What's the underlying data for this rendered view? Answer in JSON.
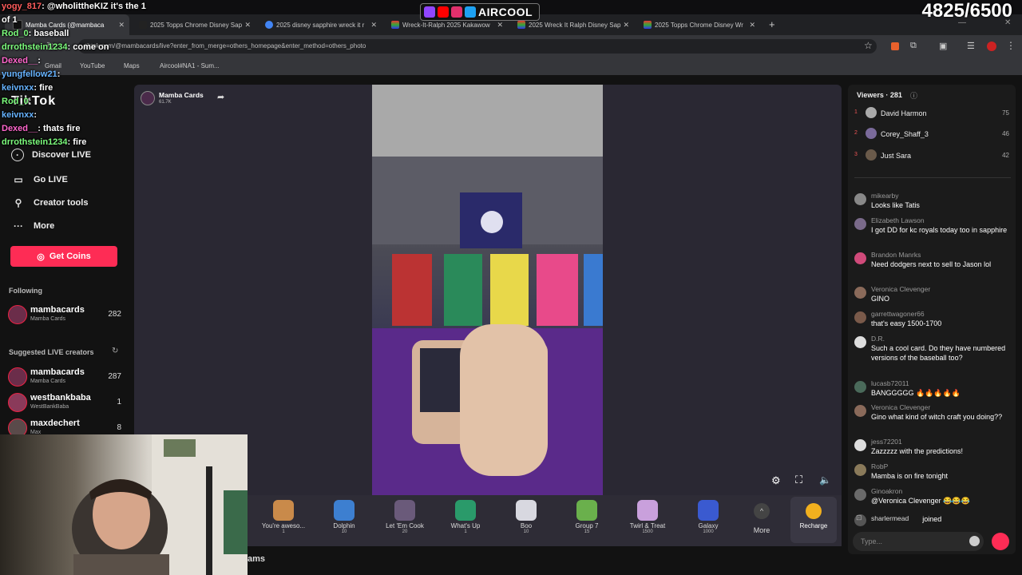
{
  "overlay": {
    "brand": "AIRCOOL",
    "goal_counter": "4825/6500",
    "chat": [
      {
        "user": "yogy_817",
        "text": ": @wholittheKIZ it's the 1",
        "color": "#ff5c5c"
      },
      {
        "user": "",
        "text": "of 1",
        "color": "#ffffff"
      },
      {
        "user": "Rod_0",
        "text": ": baseball",
        "color": "#7cfc7c"
      },
      {
        "user": "drrothstein1234",
        "text": ": come on",
        "color": "#7cfc7c"
      },
      {
        "user": "Dexed__",
        "text": ":",
        "color": "#ff66cc"
      },
      {
        "user": "yungfellow21",
        "text": ":",
        "color": "#66b3ff"
      },
      {
        "user": "keivnxx",
        "text": ": fire",
        "color": "#66b3ff"
      },
      {
        "user": "Rod_0",
        "text": ":",
        "color": "#7cfc7c"
      },
      {
        "user": "keivnxx",
        "text": ":",
        "color": "#66b3ff"
      },
      {
        "user": "Dexed__",
        "text": ": thats fire",
        "color": "#ff66cc"
      },
      {
        "user": "drrothstein1234",
        "text": ": fire",
        "color": "#7cfc7c"
      }
    ]
  },
  "browser": {
    "tabs": [
      {
        "label": "Mamba Cards (@mambaca",
        "active": true
      },
      {
        "label": "2025 Topps Chrome Disney Sap",
        "active": false
      },
      {
        "label": "2025 disney sapphire wreck it r",
        "active": false
      },
      {
        "label": "Wreck-It-Ralph 2025 Kakawow",
        "active": false
      },
      {
        "label": "2025 Wreck It Ralph Disney Sap",
        "active": false
      },
      {
        "label": "2025 Topps Chrome Disney Wr",
        "active": false
      }
    ],
    "url": "tiktok.com/@mambacards/live?enter_from_merge=others_homepage&enter_method=others_photo",
    "bookmarks": [
      "Gmail",
      "YouTube",
      "Maps",
      "Aircool#NA1 - Sum..."
    ]
  },
  "sidebar": {
    "logo": "TikTok",
    "nav": [
      {
        "label": "Discover LIVE",
        "icon": "live-icon"
      },
      {
        "label": "Go LIVE",
        "icon": "camera-icon"
      },
      {
        "label": "Creator tools",
        "icon": "lightbulb-icon"
      },
      {
        "label": "More",
        "icon": "more-icon"
      }
    ],
    "get_coins": "Get Coins",
    "following_heading": "Following",
    "following": [
      {
        "name": "mambacards",
        "sub": "Mamba Cards",
        "count": "282"
      }
    ],
    "suggested_heading": "Suggested LIVE creators",
    "suggested": [
      {
        "name": "mambacards",
        "sub": "Mamba Cards",
        "count": "287"
      },
      {
        "name": "westbankbaba",
        "sub": "WestBankBaba",
        "count": "1"
      },
      {
        "name": "maxdechert",
        "sub": "Max",
        "count": "8"
      }
    ]
  },
  "host": {
    "name": "Mamba Cards",
    "likes": "61.7K"
  },
  "gifts": [
    {
      "name": "You're aweso...",
      "price": "1",
      "color": "#c98a4a"
    },
    {
      "name": "Dolphin",
      "price": "10",
      "color": "#3d7fd0"
    },
    {
      "name": "Let 'Em Cook",
      "price": "20",
      "color": "#6a5a7a"
    },
    {
      "name": "What's Up",
      "price": "1",
      "color": "#2a9a6a"
    },
    {
      "name": "Boo",
      "price": "10",
      "color": "#d8d8e0"
    },
    {
      "name": "Group 7",
      "price": "15",
      "color": "#6ab04c"
    },
    {
      "name": "Twirl & Treat",
      "price": "1500",
      "color": "#c9a0dc"
    },
    {
      "name": "Galaxy",
      "price": "1000",
      "color": "#3a5ad0"
    }
  ],
  "gift_more": "More",
  "recharge": "Recharge",
  "viewers": {
    "heading": "Viewers · 281",
    "list": [
      {
        "rank": "1",
        "name": "David Harmon",
        "count": "75"
      },
      {
        "rank": "2",
        "name": "Corey_Shaff_3",
        "count": "46"
      },
      {
        "rank": "3",
        "name": "Just Sara",
        "count": "42"
      }
    ]
  },
  "chat": [
    {
      "user": "mikearby",
      "text": "Looks like Tatis",
      "av": "#888"
    },
    {
      "user": "Elizabeth Lawson",
      "text": "I got DD for kc royals today too in sapphire",
      "av": "#7a6a8a"
    },
    {
      "user": "Brandon Manrks",
      "text": "Need dodgers next to sell to Jason lol",
      "av": "#d04a7a"
    },
    {
      "user": "Veronica Clevenger",
      "text": "GINO",
      "av": "#8a6a5a"
    },
    {
      "user": "garrettwagoner66",
      "text": "that's easy 1500-1700",
      "av": "#7a5a4a"
    },
    {
      "user": "D.R.",
      "text": "Such a cool card. Do they have numbered versions of the baseball too?",
      "av": "#ddd"
    },
    {
      "user": "lucasb72011",
      "text": "BANGGGGG 🔥🔥🔥🔥🔥",
      "av": "#4a6a5a"
    },
    {
      "user": "Veronica Clevenger",
      "text": "Gino what kind of witch craft you doing??",
      "av": "#8a6a5a"
    },
    {
      "user": "jess72201",
      "text": "Zazzzzz with the predictions!",
      "av": "#ddd"
    },
    {
      "user": "RobP",
      "text": "Mamba is on fire tonight",
      "av": "#8a7a5a"
    },
    {
      "user": "Ginoakron",
      "text": "@Veronica Clevenger 😂😂😂",
      "av": "#6a6a6a"
    },
    {
      "user": "sharlermead",
      "text": "joined",
      "av": "#555"
    }
  ],
  "chat_input_placeholder": "Type...",
  "bottom_text": "ams"
}
